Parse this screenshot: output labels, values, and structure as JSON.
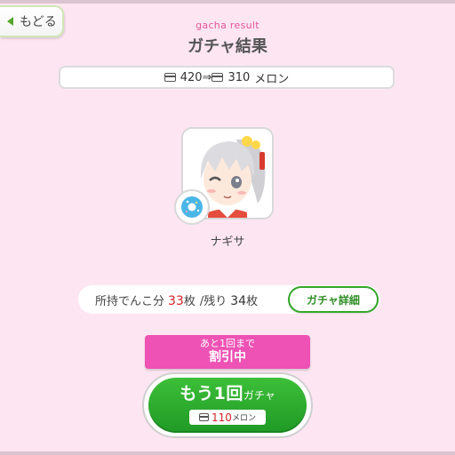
{
  "nav": {
    "back_label": "もどる",
    "back_icon": "chevron-left-icon"
  },
  "header": {
    "subtitle": "gacha result",
    "title": "ガチャ結果"
  },
  "price_summary": {
    "before": "420",
    "arrow": "⇒",
    "after": "310",
    "unit": "メロン",
    "icon": "melon-card-icon"
  },
  "result": {
    "character_name": "ナギサ",
    "badge_icon": "donut-gem-icon"
  },
  "holdings": {
    "label_prefix": "所持でんこ分",
    "owned": "33",
    "owned_unit": "枚",
    "remaining_label": "/残り",
    "remaining": "34",
    "remaining_unit": "枚",
    "detail_button": "ガチャ詳細"
  },
  "discount": {
    "line1": "あと1回まで",
    "line2": "割引中"
  },
  "gacha_button": {
    "main_label": "もう1回",
    "suffix": "ガチャ",
    "price": "110",
    "price_unit": "メロン"
  },
  "colors": {
    "background": "#fde6f2",
    "accent_pink": "#ee52b4",
    "accent_green": "#36a629",
    "highlight_red": "#d8232a"
  }
}
